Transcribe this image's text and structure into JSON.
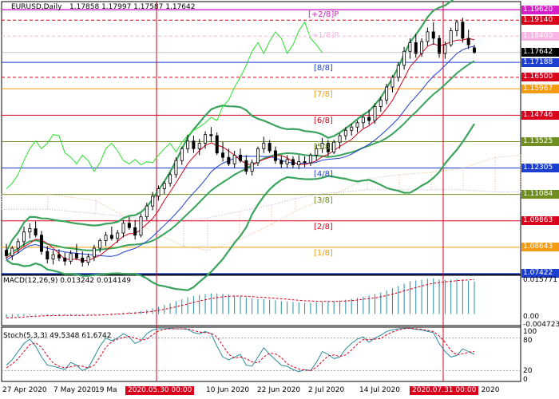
{
  "header": {
    "symbol": "EURUSD,Daily",
    "ohlc": "1.17858 1.17997 1.17587 1.17642"
  },
  "macd_header": "MACD(12,26,9) 0.013242 0.014149",
  "stoch_header": "Stoch(5,3,3) 49.5348 61.6742",
  "price_axis": [
    {
      "text": "1.19620",
      "price": 1.1962,
      "bg": "#d61fc8",
      "fg": "#ffffff"
    },
    {
      "text": "1.19140",
      "price": 1.1914,
      "bg": "#d9001b",
      "fg": "#ffffff"
    },
    {
      "text": "1.18400",
      "price": 1.184,
      "bg": "#f7b6e4",
      "fg": "#ffffff"
    },
    {
      "text": "1.17642",
      "price": 1.17642,
      "bg": "#000000",
      "fg": "#ffffff"
    },
    {
      "text": "1.17188",
      "price": 1.17188,
      "bg": "#1b3fd1",
      "fg": "#ffffff"
    },
    {
      "text": "1.16500",
      "price": 1.165,
      "bg": "#d9001b",
      "fg": "#ffffff"
    },
    {
      "text": "1.15967",
      "price": 1.15967,
      "bg": "#f39c12",
      "fg": "#ffffff"
    },
    {
      "text": "1.14746",
      "price": 1.14746,
      "bg": "#d9001b",
      "fg": "#ffffff"
    },
    {
      "text": "1.13525",
      "price": 1.13525,
      "bg": "#6e8f1e",
      "fg": "#ffffff"
    },
    {
      "text": "1.12305",
      "price": 1.12305,
      "bg": "#1b3fd1",
      "fg": "#ffffff"
    },
    {
      "text": "1.11084",
      "price": 1.11084,
      "bg": "#6e8f1e",
      "fg": "#ffffff"
    },
    {
      "text": "1.09863",
      "price": 1.09863,
      "bg": "#d9001b",
      "fg": "#ffffff"
    },
    {
      "text": "1.08643",
      "price": 1.08643,
      "bg": "#f39c12",
      "fg": "#ffffff"
    },
    {
      "text": "1.07422",
      "price": 1.07422,
      "bg": "#1b3fd1",
      "fg": "#ffffff"
    }
  ],
  "murrey_labels": [
    {
      "text": "[+2/8]P",
      "price": 1.1962,
      "color": "#d61fc8"
    },
    {
      "text": "[+1/8]P",
      "price": 1.184,
      "color": "#f7b6e4"
    },
    {
      "text": "[8/8]",
      "price": 1.17188,
      "color": "#1b3fd1"
    },
    {
      "text": "[7/8]",
      "price": 1.15967,
      "color": "#f39c12"
    },
    {
      "text": "[6/8]",
      "price": 1.14746,
      "color": "#d9001b"
    },
    {
      "text": "[5/8]",
      "price": 1.13525,
      "color": "#6e8f1e"
    },
    {
      "text": "[4/8]",
      "price": 1.12305,
      "color": "#1b3fd1"
    },
    {
      "text": "[3/8]",
      "price": 1.11084,
      "color": "#6e8f1e"
    },
    {
      "text": "[2/8]",
      "price": 1.09863,
      "color": "#d9001b"
    },
    {
      "text": "[1/8]",
      "price": 1.08643,
      "color": "#f39c12"
    }
  ],
  "macd_axis": [
    "0.015771",
    "0.00",
    "-0.004723"
  ],
  "stoch_axis": [
    "100",
    "80",
    "20",
    "0"
  ],
  "date_labels": [
    "27 Apr 2020",
    "7 May 2020",
    "19 Ma",
    "10 Jun 2020",
    "22 Jun 2020",
    "2 Jul 2020",
    "14 Jul 2020",
    "g 2020"
  ],
  "vline_tags": [
    "2020.05.30 00:00",
    "2020.07.31 00:00"
  ],
  "chart_data": {
    "type": "candlestick",
    "symbol": "EURUSD",
    "timeframe": "Daily",
    "ylim": [
      1.0742,
      1.1985
    ],
    "candles": [
      {
        "o": 1.085,
        "h": 1.088,
        "l": 1.081,
        "c": 1.0825
      },
      {
        "o": 1.0825,
        "h": 1.087,
        "l": 1.0805,
        "c": 1.086
      },
      {
        "o": 1.086,
        "h": 1.0905,
        "l": 1.0835,
        "c": 1.089
      },
      {
        "o": 1.089,
        "h": 1.096,
        "l": 1.087,
        "c": 1.0935
      },
      {
        "o": 1.0935,
        "h": 1.0975,
        "l": 1.0905,
        "c": 1.095
      },
      {
        "o": 1.095,
        "h": 1.0985,
        "l": 1.091,
        "c": 1.092
      },
      {
        "o": 1.092,
        "h": 1.094,
        "l": 1.083,
        "c": 1.0845
      },
      {
        "o": 1.0845,
        "h": 1.087,
        "l": 1.079,
        "c": 1.081
      },
      {
        "o": 1.081,
        "h": 1.085,
        "l": 1.0785,
        "c": 1.083
      },
      {
        "o": 1.083,
        "h": 1.0855,
        "l": 1.08,
        "c": 1.0815
      },
      {
        "o": 1.0815,
        "h": 1.084,
        "l": 1.078,
        "c": 1.08
      },
      {
        "o": 1.08,
        "h": 1.085,
        "l": 1.0785,
        "c": 1.0835
      },
      {
        "o": 1.0835,
        "h": 1.088,
        "l": 1.0805,
        "c": 1.0815
      },
      {
        "o": 1.0815,
        "h": 1.0845,
        "l": 1.0775,
        "c": 1.0795
      },
      {
        "o": 1.0795,
        "h": 1.0835,
        "l": 1.078,
        "c": 1.082
      },
      {
        "o": 1.082,
        "h": 1.0875,
        "l": 1.08,
        "c": 1.086
      },
      {
        "o": 1.086,
        "h": 1.0905,
        "l": 1.084,
        "c": 1.0895
      },
      {
        "o": 1.0895,
        "h": 1.0935,
        "l": 1.087,
        "c": 1.092
      },
      {
        "o": 1.092,
        "h": 1.096,
        "l": 1.0895,
        "c": 1.0905
      },
      {
        "o": 1.0905,
        "h": 1.0945,
        "l": 1.0885,
        "c": 1.093
      },
      {
        "o": 1.093,
        "h": 1.099,
        "l": 1.091,
        "c": 1.0975
      },
      {
        "o": 1.0975,
        "h": 1.1005,
        "l": 1.0945,
        "c": 1.0955
      },
      {
        "o": 1.0955,
        "h": 1.099,
        "l": 1.09,
        "c": 1.092
      },
      {
        "o": 1.092,
        "h": 1.102,
        "l": 1.091,
        "c": 1.1005
      },
      {
        "o": 1.1005,
        "h": 1.107,
        "l": 1.099,
        "c": 1.1055
      },
      {
        "o": 1.1055,
        "h": 1.112,
        "l": 1.1035,
        "c": 1.11
      },
      {
        "o": 1.11,
        "h": 1.115,
        "l": 1.108,
        "c": 1.1135
      },
      {
        "o": 1.1135,
        "h": 1.117,
        "l": 1.111,
        "c": 1.116
      },
      {
        "o": 1.116,
        "h": 1.121,
        "l": 1.1145,
        "c": 1.12
      },
      {
        "o": 1.12,
        "h": 1.128,
        "l": 1.1185,
        "c": 1.1265
      },
      {
        "o": 1.1265,
        "h": 1.133,
        "l": 1.1245,
        "c": 1.132
      },
      {
        "o": 1.132,
        "h": 1.1385,
        "l": 1.13,
        "c": 1.1355
      },
      {
        "o": 1.1355,
        "h": 1.138,
        "l": 1.13,
        "c": 1.132
      },
      {
        "o": 1.132,
        "h": 1.1365,
        "l": 1.129,
        "c": 1.1345
      },
      {
        "o": 1.1345,
        "h": 1.14,
        "l": 1.132,
        "c": 1.1385
      },
      {
        "o": 1.1385,
        "h": 1.142,
        "l": 1.135,
        "c": 1.138
      },
      {
        "o": 1.138,
        "h": 1.1395,
        "l": 1.129,
        "c": 1.13
      },
      {
        "o": 1.13,
        "h": 1.135,
        "l": 1.126,
        "c": 1.128
      },
      {
        "o": 1.128,
        "h": 1.132,
        "l": 1.124,
        "c": 1.125
      },
      {
        "o": 1.125,
        "h": 1.131,
        "l": 1.123,
        "c": 1.129
      },
      {
        "o": 1.129,
        "h": 1.132,
        "l": 1.1255,
        "c": 1.1265
      },
      {
        "o": 1.1265,
        "h": 1.129,
        "l": 1.12,
        "c": 1.1215
      },
      {
        "o": 1.1215,
        "h": 1.127,
        "l": 1.1195,
        "c": 1.1255
      },
      {
        "o": 1.1255,
        "h": 1.133,
        "l": 1.124,
        "c": 1.132
      },
      {
        "o": 1.132,
        "h": 1.1375,
        "l": 1.13,
        "c": 1.1345
      },
      {
        "o": 1.1345,
        "h": 1.136,
        "l": 1.13,
        "c": 1.131
      },
      {
        "o": 1.131,
        "h": 1.133,
        "l": 1.125,
        "c": 1.1265
      },
      {
        "o": 1.1265,
        "h": 1.129,
        "l": 1.123,
        "c": 1.125
      },
      {
        "o": 1.125,
        "h": 1.129,
        "l": 1.123,
        "c": 1.127
      },
      {
        "o": 1.127,
        "h": 1.1285,
        "l": 1.123,
        "c": 1.1245
      },
      {
        "o": 1.1245,
        "h": 1.129,
        "l": 1.1225,
        "c": 1.126
      },
      {
        "o": 1.126,
        "h": 1.1285,
        "l": 1.1235,
        "c": 1.1255
      },
      {
        "o": 1.1255,
        "h": 1.13,
        "l": 1.124,
        "c": 1.129
      },
      {
        "o": 1.129,
        "h": 1.134,
        "l": 1.1265,
        "c": 1.132
      },
      {
        "o": 1.132,
        "h": 1.137,
        "l": 1.13,
        "c": 1.1345
      },
      {
        "o": 1.1345,
        "h": 1.136,
        "l": 1.1285,
        "c": 1.1305
      },
      {
        "o": 1.1305,
        "h": 1.136,
        "l": 1.1295,
        "c": 1.135
      },
      {
        "o": 1.135,
        "h": 1.139,
        "l": 1.132,
        "c": 1.138
      },
      {
        "o": 1.138,
        "h": 1.142,
        "l": 1.136,
        "c": 1.1405
      },
      {
        "o": 1.1405,
        "h": 1.1435,
        "l": 1.138,
        "c": 1.142
      },
      {
        "o": 1.142,
        "h": 1.145,
        "l": 1.1395,
        "c": 1.144
      },
      {
        "o": 1.144,
        "h": 1.1475,
        "l": 1.1415,
        "c": 1.1465
      },
      {
        "o": 1.1465,
        "h": 1.15,
        "l": 1.143,
        "c": 1.145
      },
      {
        "o": 1.145,
        "h": 1.153,
        "l": 1.1435,
        "c": 1.1515
      },
      {
        "o": 1.1515,
        "h": 1.156,
        "l": 1.149,
        "c": 1.1545
      },
      {
        "o": 1.1545,
        "h": 1.162,
        "l": 1.1525,
        "c": 1.1605
      },
      {
        "o": 1.1605,
        "h": 1.166,
        "l": 1.158,
        "c": 1.165
      },
      {
        "o": 1.165,
        "h": 1.172,
        "l": 1.163,
        "c": 1.1705
      },
      {
        "o": 1.1705,
        "h": 1.179,
        "l": 1.1685,
        "c": 1.177
      },
      {
        "o": 1.177,
        "h": 1.183,
        "l": 1.1735,
        "c": 1.181
      },
      {
        "o": 1.181,
        "h": 1.185,
        "l": 1.174,
        "c": 1.176
      },
      {
        "o": 1.176,
        "h": 1.183,
        "l": 1.1745,
        "c": 1.1815
      },
      {
        "o": 1.1815,
        "h": 1.188,
        "l": 1.1795,
        "c": 1.186
      },
      {
        "o": 1.186,
        "h": 1.1905,
        "l": 1.18,
        "c": 1.183
      },
      {
        "o": 1.183,
        "h": 1.1845,
        "l": 1.174,
        "c": 1.176
      },
      {
        "o": 1.176,
        "h": 1.1815,
        "l": 1.1735,
        "c": 1.18
      },
      {
        "o": 1.18,
        "h": 1.188,
        "l": 1.179,
        "c": 1.1865
      },
      {
        "o": 1.1865,
        "h": 1.1915,
        "l": 1.184,
        "c": 1.1905
      },
      {
        "o": 1.1905,
        "h": 1.1925,
        "l": 1.181,
        "c": 1.183
      },
      {
        "o": 1.183,
        "h": 1.187,
        "l": 1.178,
        "c": 1.18
      },
      {
        "o": 1.1786,
        "h": 1.18,
        "l": 1.1759,
        "c": 1.1764
      }
    ],
    "macd_ylim": [
      -0.004723,
      0.015771
    ],
    "macd_hist": [
      -0.0015,
      -0.0013,
      -0.0011,
      -0.0008,
      -0.0006,
      -0.0004,
      -0.0004,
      -0.0005,
      -0.0005,
      -0.0006,
      -0.0006,
      -0.0005,
      -0.0005,
      -0.0005,
      -0.0004,
      -0.0003,
      -0.0001,
      0.0001,
      0.0003,
      0.0004,
      0.0006,
      0.0008,
      0.0009,
      0.0012,
      0.0017,
      0.0023,
      0.003,
      0.0037,
      0.0044,
      0.0052,
      0.006,
      0.0068,
      0.0073,
      0.0077,
      0.0081,
      0.0084,
      0.0084,
      0.0082,
      0.0079,
      0.0076,
      0.0072,
      0.0068,
      0.0064,
      0.0062,
      0.0061,
      0.0059,
      0.0056,
      0.0053,
      0.0051,
      0.0049,
      0.0047,
      0.0046,
      0.0046,
      0.0047,
      0.0049,
      0.005,
      0.0052,
      0.0055,
      0.0058,
      0.0062,
      0.0066,
      0.0071,
      0.0075,
      0.0081,
      0.0088,
      0.0096,
      0.0105,
      0.0114,
      0.0124,
      0.0133,
      0.0137,
      0.014,
      0.0144,
      0.0145,
      0.0141,
      0.0139,
      0.014,
      0.0143,
      0.014,
      0.0135,
      0.0132
    ],
    "macd_signal": [
      -0.0016,
      -0.0015,
      -0.0014,
      -0.0012,
      -0.001,
      -0.0009,
      -0.0008,
      -0.0007,
      -0.0007,
      -0.0006,
      -0.0006,
      -0.0006,
      -0.0006,
      -0.0006,
      -0.0005,
      -0.0005,
      -0.0004,
      -0.0003,
      -0.0002,
      0.0,
      0.0001,
      0.0003,
      0.0004,
      0.0006,
      0.0008,
      0.0011,
      0.0015,
      0.0019,
      0.0024,
      0.0029,
      0.0035,
      0.0041,
      0.0047,
      0.0053,
      0.0058,
      0.0063,
      0.0067,
      0.007,
      0.0072,
      0.0073,
      0.0073,
      0.0072,
      0.0071,
      0.0069,
      0.0068,
      0.0066,
      0.0064,
      0.0062,
      0.006,
      0.0058,
      0.0056,
      0.0054,
      0.0053,
      0.0052,
      0.0051,
      0.0051,
      0.0051,
      0.0052,
      0.0053,
      0.0055,
      0.0057,
      0.006,
      0.0063,
      0.0066,
      0.007,
      0.0075,
      0.0081,
      0.0087,
      0.0094,
      0.0101,
      0.0108,
      0.0114,
      0.012,
      0.0125,
      0.0128,
      0.0131,
      0.0133,
      0.0136,
      0.0138,
      0.0139,
      0.0141
    ],
    "stoch_main": [
      30,
      40,
      55,
      70,
      78,
      65,
      45,
      30,
      28,
      25,
      22,
      35,
      30,
      20,
      25,
      45,
      65,
      80,
      75,
      80,
      88,
      82,
      70,
      75,
      88,
      95,
      97,
      97,
      98,
      97,
      97,
      96,
      90,
      88,
      92,
      88,
      65,
      45,
      40,
      45,
      50,
      30,
      28,
      45,
      62,
      50,
      40,
      30,
      28,
      22,
      18,
      22,
      20,
      35,
      55,
      50,
      42,
      45,
      60,
      70,
      78,
      82,
      72,
      80,
      85,
      92,
      95,
      97,
      98,
      98,
      96,
      95,
      92,
      90,
      70,
      55,
      45,
      48,
      60,
      55,
      50
    ],
    "stoch_signal": [
      25,
      32,
      42,
      55,
      68,
      71,
      63,
      47,
      34,
      28,
      25,
      27,
      29,
      28,
      25,
      30,
      45,
      63,
      73,
      78,
      81,
      83,
      80,
      76,
      78,
      86,
      93,
      96,
      97,
      97,
      97,
      97,
      94,
      91,
      90,
      89,
      82,
      66,
      50,
      43,
      45,
      42,
      36,
      34,
      45,
      52,
      51,
      44,
      33,
      27,
      23,
      21,
      20,
      26,
      37,
      47,
      49,
      46,
      49,
      58,
      69,
      77,
      77,
      78,
      79,
      86,
      91,
      95,
      97,
      98,
      97,
      96,
      94,
      92,
      84,
      72,
      57,
      49,
      51,
      54,
      55
    ]
  }
}
